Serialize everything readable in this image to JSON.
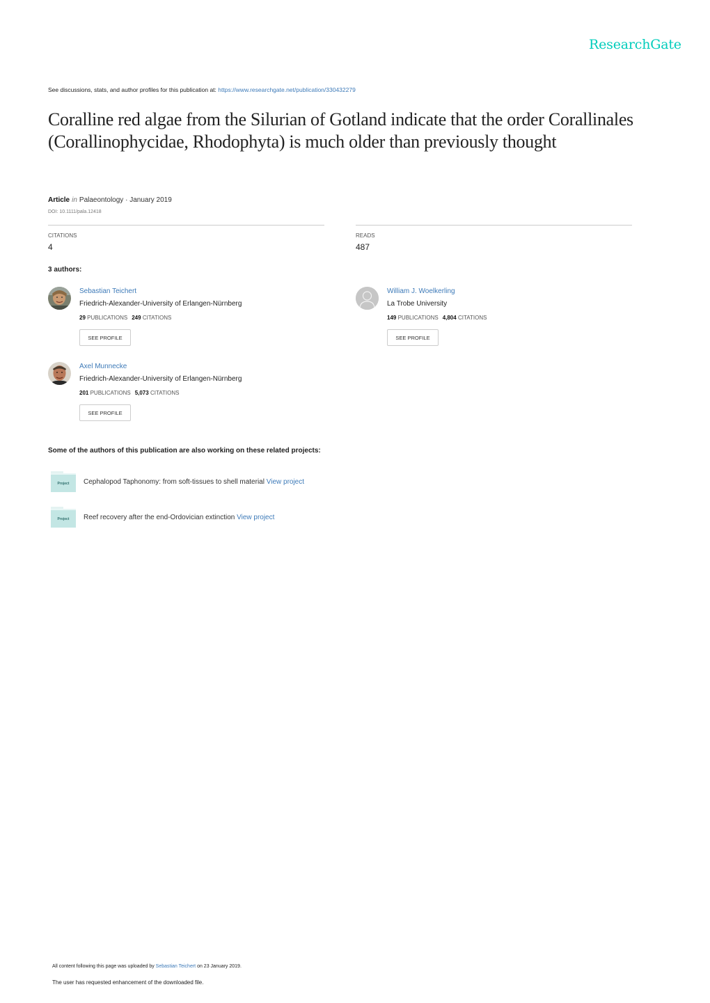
{
  "header": {
    "brand": "ResearchGate"
  },
  "intro": {
    "text": "See discussions, stats, and author profiles for this publication at: ",
    "url": "https://www.researchgate.net/publication/330432279"
  },
  "publication": {
    "title": "Coralline red algae from the Silurian of Gotland indicate that the order Corallinales (Corallinophycidae, Rhodophyta) is much older than previously thought",
    "type": "Article",
    "in_word": "in",
    "journal_date": "Palaeontology · January 2019",
    "doi": "DOI: 10.1111/pala.12418"
  },
  "stats": {
    "citations_label": "CITATIONS",
    "citations_value": "4",
    "reads_label": "READS",
    "reads_value": "487"
  },
  "authors_heading": "3 authors:",
  "authors": [
    {
      "name": "Sebastian Teichert",
      "institution": "Friedrich-Alexander-University of Erlangen-Nürnberg",
      "publications": "29",
      "publications_label": "PUBLICATIONS",
      "citations": "249",
      "citations_label": "CITATIONS",
      "button": "SEE PROFILE",
      "avatar": "photo"
    },
    {
      "name": "William J. Woelkerling",
      "institution": "La Trobe University",
      "publications": "149",
      "publications_label": "PUBLICATIONS",
      "citations": "4,804",
      "citations_label": "CITATIONS",
      "button": "SEE PROFILE",
      "avatar": "placeholder"
    },
    {
      "name": "Axel Munnecke",
      "institution": "Friedrich-Alexander-University of Erlangen-Nürnberg",
      "publications": "201",
      "publications_label": "PUBLICATIONS",
      "citations": "5,073",
      "citations_label": "CITATIONS",
      "button": "SEE PROFILE",
      "avatar": "photo"
    }
  ],
  "projects_heading": "Some of the authors of this publication are also working on these related projects:",
  "projects": [
    {
      "icon_label": "Project",
      "title": "Cephalopod Taphonomy: from soft-tissues to shell material ",
      "link": "View project"
    },
    {
      "icon_label": "Project",
      "title": "Reef recovery after the end-Ordovician extinction ",
      "link": "View project"
    }
  ],
  "footer": {
    "uploaded_prefix": "All content following this page was uploaded by ",
    "uploader": "Sebastian Teichert",
    "uploaded_suffix": " on 23 January 2019.",
    "note": "The user has requested enhancement of the downloaded file."
  },
  "colors": {
    "brand": "#00ccbb",
    "link": "#3d7ab8",
    "project_icon": "#c3e6e4"
  }
}
